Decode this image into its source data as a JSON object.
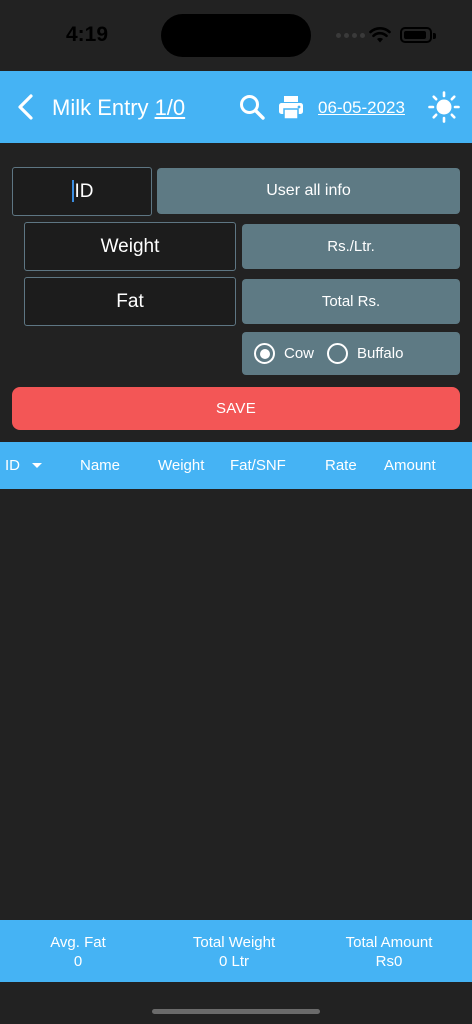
{
  "status_bar": {
    "time": "4:19"
  },
  "header": {
    "title": "Milk Entry",
    "count": "1/0",
    "date": "06-05-2023"
  },
  "form": {
    "id_field": {
      "value": "ID"
    },
    "user_info_button": "User all info",
    "weight_field": {
      "value": "Weight"
    },
    "fat_field": {
      "value": "Fat"
    },
    "rate_label": "Rs./Ltr.",
    "total_label": "Total Rs.",
    "milk_type": {
      "options": [
        "Cow",
        "Buffalo"
      ],
      "selected": "Cow"
    },
    "save_label": "SAVE"
  },
  "table": {
    "columns": [
      "ID",
      "Name",
      "Weight",
      "Fat/SNF",
      "Rate",
      "Amount"
    ],
    "rows": []
  },
  "summary": {
    "avg_fat_label": "Avg. Fat",
    "avg_fat_value": "0",
    "total_weight_label": "Total Weight",
    "total_weight_value": "0 Ltr",
    "total_amount_label": "Total Amount",
    "total_amount_value": "Rs0"
  },
  "icons": {
    "back": "chevron-left-icon",
    "search": "search-icon",
    "print": "print-icon",
    "theme": "sun-icon"
  },
  "colors": {
    "accent": "#45b3f4",
    "save": "#f35656",
    "panel": "#5e7a84",
    "background": "#222222"
  }
}
